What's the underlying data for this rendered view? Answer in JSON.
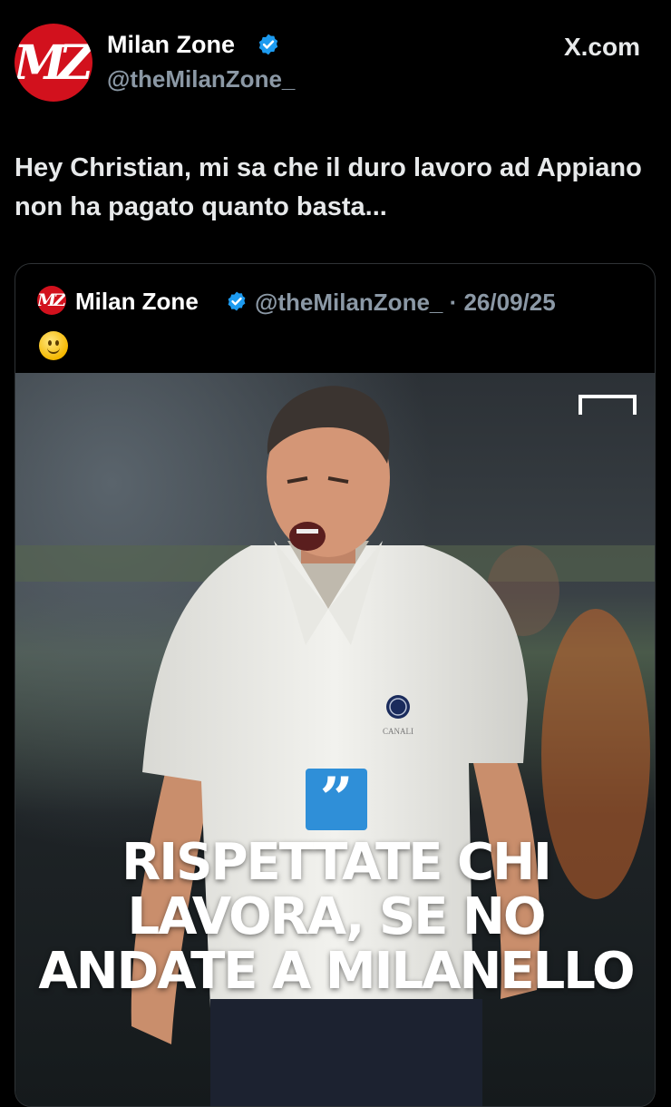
{
  "header": {
    "avatar_text": "MZ",
    "author_name": "Milan Zone",
    "author_handle": "@theMilanZone_",
    "source": "X.com"
  },
  "tweet": {
    "text": "Hey Christian, mi sa che il duro lavoro ad Appiano non ha pagato quanto basta..."
  },
  "quoted": {
    "avatar_text": "MZ",
    "author_name": "Milan Zone",
    "meta": "@theMilanZone_ · 26/09/25",
    "emoji": "slightly-smiling-face"
  },
  "image": {
    "quote_mark": "”",
    "headline": "RISPETTATE CHI LAVORA, SE NO ANDATE A MILANELLO",
    "shirt_text": "CANALI"
  },
  "colors": {
    "background": "#000000",
    "brand_red": "#d2111d",
    "verified_blue": "#1d9bf0",
    "muted": "#8b98a5",
    "quote_badge": "#2f8fd8"
  }
}
